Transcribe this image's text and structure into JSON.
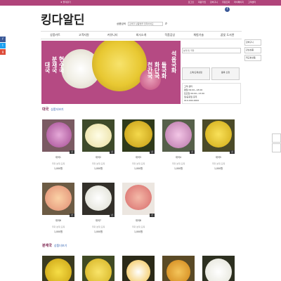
{
  "topbar": {
    "bookmark": "★ 즐겨찾기",
    "links": [
      "로그인",
      "회원가입",
      "장바구니",
      "주문조회",
      "마이페이지",
      "고객센터"
    ]
  },
  "logo": "킹다알딘",
  "search": {
    "label": "상품검색",
    "placeholder": "검색할 상품명을 입력하세요"
  },
  "nav": [
    "상품카트",
    "고객지원",
    "커뮤니티",
    "회사소개",
    "작품감상",
    "체험기술",
    "꿈빛 도서관"
  ],
  "social": [
    "f",
    "t",
    "g"
  ],
  "banner": {
    "col1": "대국",
    "col2": "분재국",
    "col3": "현수국",
    "col4": "천간국",
    "col5": "화단국",
    "col6": "들국화",
    "col7": "석용국화"
  },
  "sidebox": {
    "search_placeholder": "분재 및 국화",
    "btn1": "소매/도매상점",
    "btn2": "품목 신청",
    "info_title": "고객 센터",
    "info_lines": [
      "평일 09:00~18:00",
      "토요일 09:00~13:00",
      "일/공휴일 휴무",
      "010-000-0000"
    ]
  },
  "rightcol": [
    "장바구니",
    "관심상품",
    "최근본상품"
  ],
  "sec1": {
    "title": "대국",
    "more": "상품더보기"
  },
  "sec2": {
    "title": "분재국",
    "more": "상품더보기"
  },
  "products_row1": [
    {
      "name": "대국1",
      "desc": "국화 분재 묘목",
      "price": "1,000원",
      "tag": "신"
    },
    {
      "name": "대국2",
      "desc": "국화 분재 묘목",
      "price": "1,000원",
      "tag": "신"
    },
    {
      "name": "대국3",
      "desc": "국화 분재 묘목",
      "price": "1,000원",
      "tag": "신"
    },
    {
      "name": "대국4",
      "desc": "국화 분재 묘목",
      "price": "1,000원",
      "tag": "신"
    },
    {
      "name": "대국5",
      "desc": "국화 분재 묘목",
      "price": "1,000원",
      "tag": "신"
    }
  ],
  "products_row2": [
    {
      "name": "대국6",
      "desc": "국화 분재 묘목",
      "price": "1,000원",
      "tag": "신"
    },
    {
      "name": "대국7",
      "desc": "국화 분재 묘목",
      "price": "1,000원",
      "tag": "신"
    },
    {
      "name": "대국8",
      "desc": "국화 분재 묘목",
      "price": "1,000원",
      "tag": "신"
    }
  ],
  "colors": {
    "accent": "#b0447a",
    "banner": "#b54a83",
    "section_title": "#7a1f4b",
    "link": "#2a5db0"
  }
}
